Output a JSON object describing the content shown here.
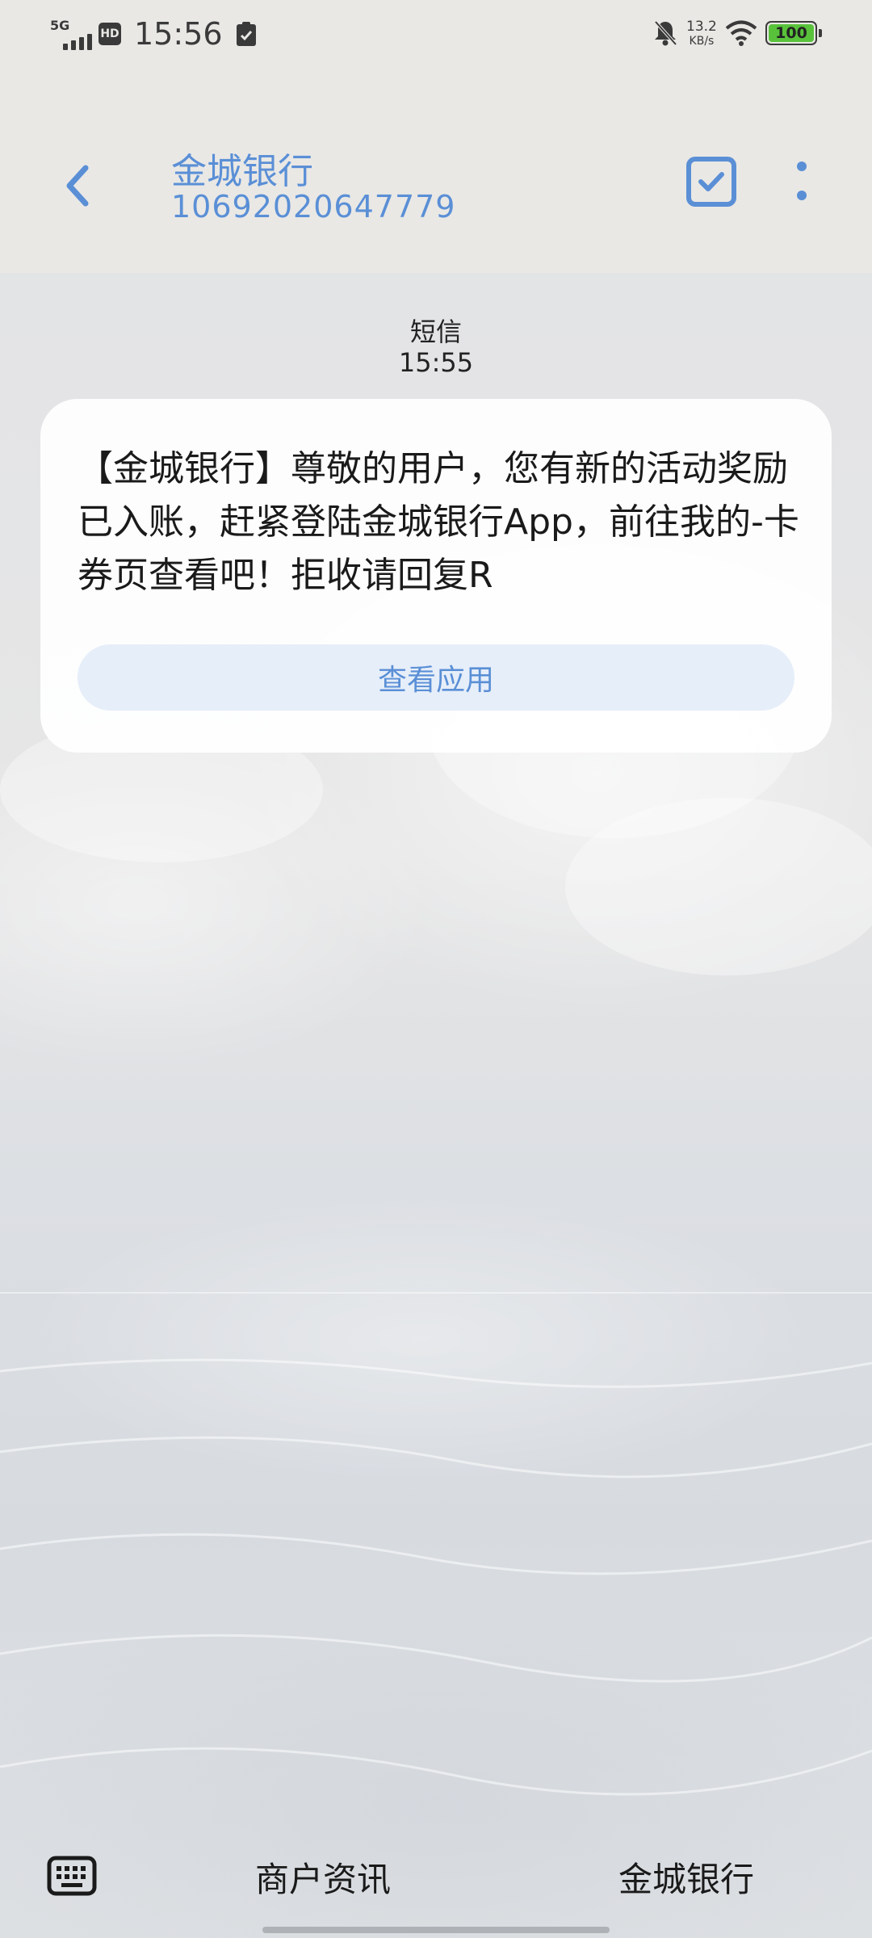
{
  "status_bar": {
    "network": "5G",
    "hd": "HD",
    "time": "15:56",
    "net_speed_value": "13.2",
    "net_speed_unit": "KB/s",
    "battery": "100",
    "icons": [
      "signal-icon",
      "hd-icon",
      "clipboard-check-icon",
      "bell-off-icon",
      "wifi-icon",
      "battery-icon"
    ]
  },
  "header": {
    "contact_name": "金城银行",
    "contact_number": "10692020647779",
    "accent_color": "#5a8fd6",
    "icons": [
      "back-icon",
      "select-icon",
      "more-icon"
    ]
  },
  "conversation": {
    "channel": "短信",
    "time": "15:55",
    "message": "【金城银行】尊敬的用户，您有新的活动奖励已入账，赶紧登陆金城银行App，前往我的-卡券页查看吧！拒收请回复R",
    "action_button": "查看应用"
  },
  "bottom_bar": {
    "menu_items": [
      "商户资讯",
      "金城银行"
    ],
    "icons": [
      "keyboard-icon"
    ]
  }
}
